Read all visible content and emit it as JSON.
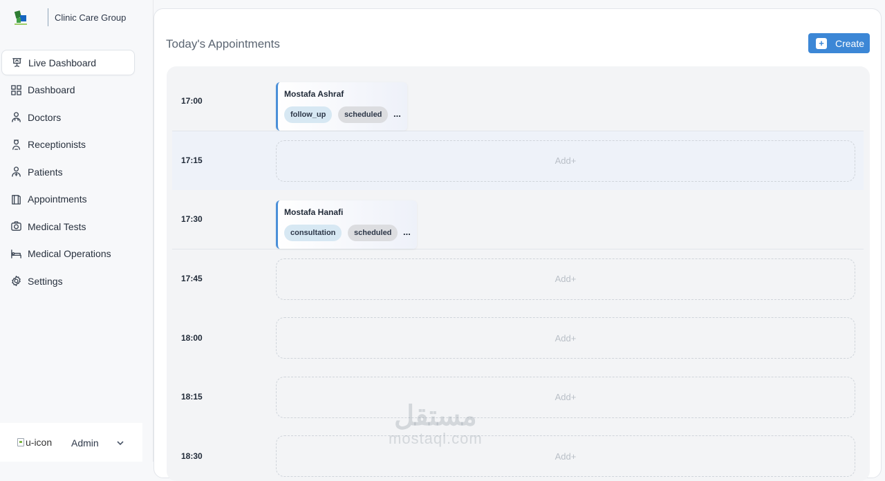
{
  "brand": {
    "name": "Clinic Care Group"
  },
  "sidebar": {
    "items": [
      {
        "label": "Live Dashboard",
        "icon": "presentation-icon",
        "active": true
      },
      {
        "label": "Dashboard",
        "icon": "grid-icon"
      },
      {
        "label": "Doctors",
        "icon": "doctor-icon"
      },
      {
        "label": "Receptionists",
        "icon": "receptionist-icon"
      },
      {
        "label": "Patients",
        "icon": "patient-icon"
      },
      {
        "label": "Appointments",
        "icon": "book-icon"
      },
      {
        "label": "Medical Tests",
        "icon": "test-icon"
      },
      {
        "label": "Medical Operations",
        "icon": "bed-icon"
      },
      {
        "label": "Settings",
        "icon": "gear-icon"
      }
    ]
  },
  "user": {
    "avatar_alt": "u-icon",
    "name": "Admin"
  },
  "main": {
    "title": "Today's Appointments",
    "create_label": "Create",
    "add_label": "Add+"
  },
  "slots": [
    {
      "time": "17:00",
      "appointment": {
        "patient": "Mostafa Ashraf",
        "type": "follow_up",
        "status": "scheduled"
      }
    },
    {
      "time": "17:15"
    },
    {
      "time": "17:30",
      "appointment": {
        "patient": "Mostafa Hanafi",
        "type": "consultation",
        "status": "scheduled"
      }
    },
    {
      "time": "17:45"
    },
    {
      "time": "18:00"
    },
    {
      "time": "18:15"
    },
    {
      "time": "18:30"
    }
  ],
  "watermark": {
    "arabic": "مستقل",
    "latin": "mostaql.com"
  },
  "colors": {
    "accent": "#3c87d6",
    "tag_type": "#d7e8f3",
    "tag_status": "#dcdde0"
  }
}
